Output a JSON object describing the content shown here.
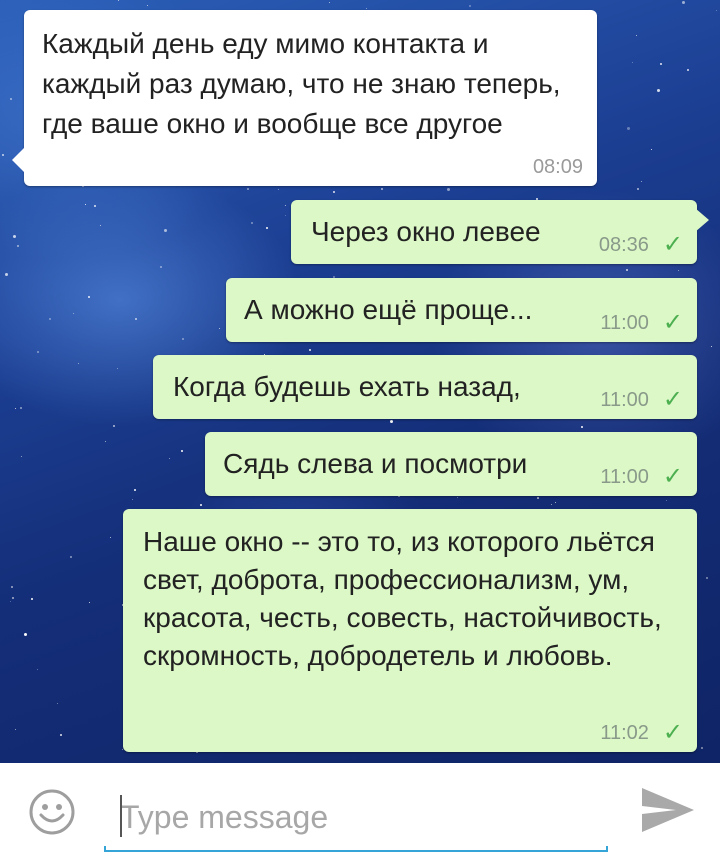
{
  "conversation": {
    "messages": [
      {
        "direction": "incoming",
        "text": "Каждый день еду мимо контакта и каждый раз думаю, что не знаю теперь, где ваше окно и вообще все другое",
        "time": "08:09",
        "read": false
      },
      {
        "direction": "outgoing",
        "text": "Через окно левее",
        "time": "08:36",
        "read": true
      },
      {
        "direction": "outgoing",
        "text": "А можно ещё проще...",
        "time": "11:00",
        "read": true
      },
      {
        "direction": "outgoing",
        "text": "Когда будешь ехать назад,",
        "time": "11:00",
        "read": true
      },
      {
        "direction": "outgoing",
        "text": "Сядь слева и посмотри",
        "time": "11:00",
        "read": true
      },
      {
        "direction": "outgoing",
        "text": "Наше окно -- это то, из которого льётся свет, доброта, профессионализм, ум, красота, честь, совесть, настойчивость, скромность, добродетель и любовь.",
        "time": "11:02",
        "read": true
      }
    ]
  },
  "composer": {
    "placeholder": "Type message",
    "value": "",
    "emoji_icon": "smiley-face-icon",
    "send_icon": "paper-plane-send-icon"
  },
  "colors": {
    "incoming_bubble": "#ffffff",
    "outgoing_bubble": "#dcf8c6",
    "read_check": "#4caf50",
    "input_underline": "#34a5d6"
  }
}
